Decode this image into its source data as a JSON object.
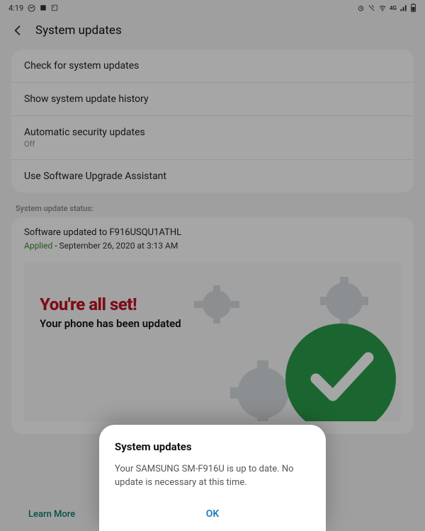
{
  "status_bar": {
    "time": "4:19",
    "left_icons": [
      "messenger",
      "badge",
      "image"
    ],
    "right_icons": [
      "alarm",
      "vibrate",
      "wifi",
      "4G",
      "signal",
      "battery"
    ]
  },
  "header": {
    "title": "System updates"
  },
  "menu": {
    "check": "Check for system updates",
    "history": "Show system update history",
    "auto": {
      "label": "Automatic security updates",
      "value": "Off"
    },
    "assistant": "Use Software Upgrade Assistant"
  },
  "status": {
    "section_label": "System update status:",
    "version_line": "Software updated to F916USQU1ATHL",
    "applied_label": "Applied",
    "applied_date": " - September 26, 2020 at 3:13 AM"
  },
  "promo": {
    "headline": "You're all set!",
    "subline": "Your phone has been updated",
    "learn_more": "Learn More"
  },
  "dialog": {
    "title": "System updates",
    "body": "Your SAMSUNG SM-F916U is up to date. No update is necessary at this time.",
    "ok": "OK"
  },
  "colors": {
    "accent_red": "#c11426",
    "accent_green": "#2a9d4a",
    "link_teal": "#0a7d6c",
    "ok_blue": "#1a7cc2"
  }
}
